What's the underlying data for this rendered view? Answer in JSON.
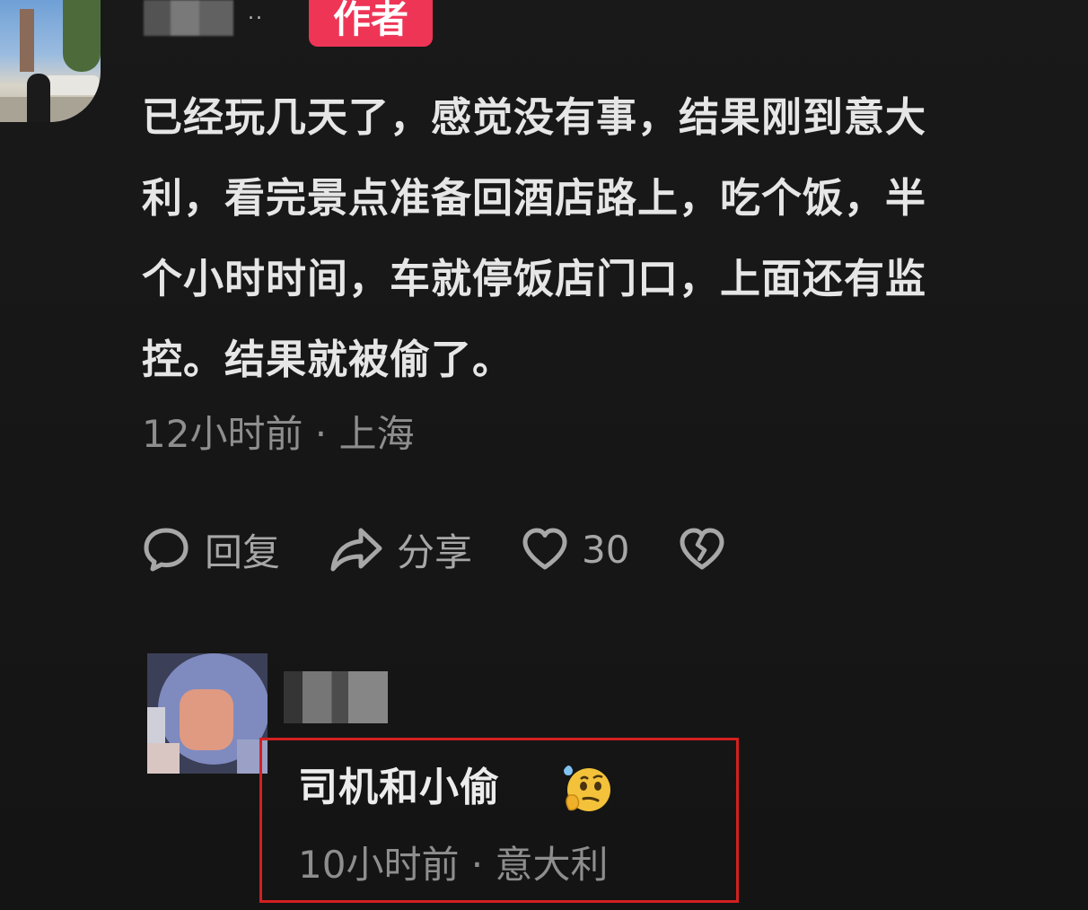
{
  "comment": {
    "badge": "作者",
    "username_dots": "..",
    "lines": [
      "已经玩几天了，感觉没有事，结果刚到意大",
      "利，看完景点准备回酒店路上，吃个饭，半",
      "个小时时间，车就停饭店门口，上面还有监",
      "控。结果就被偷了。"
    ],
    "meta": "12小时前 · 上海",
    "actions": {
      "reply_label": "回复",
      "share_label": "分享",
      "like_count": "30"
    }
  },
  "reply": {
    "text": "司机和小偷",
    "emoji": "thinking-face-with-sweat-emoji",
    "meta": "10小时前 · 意大利"
  },
  "colors": {
    "background": "#161616",
    "badge": "#ee3556",
    "highlight_border": "#d3201f",
    "primary_text": "#e6e6e6",
    "secondary_text": "#8e8e8e"
  }
}
